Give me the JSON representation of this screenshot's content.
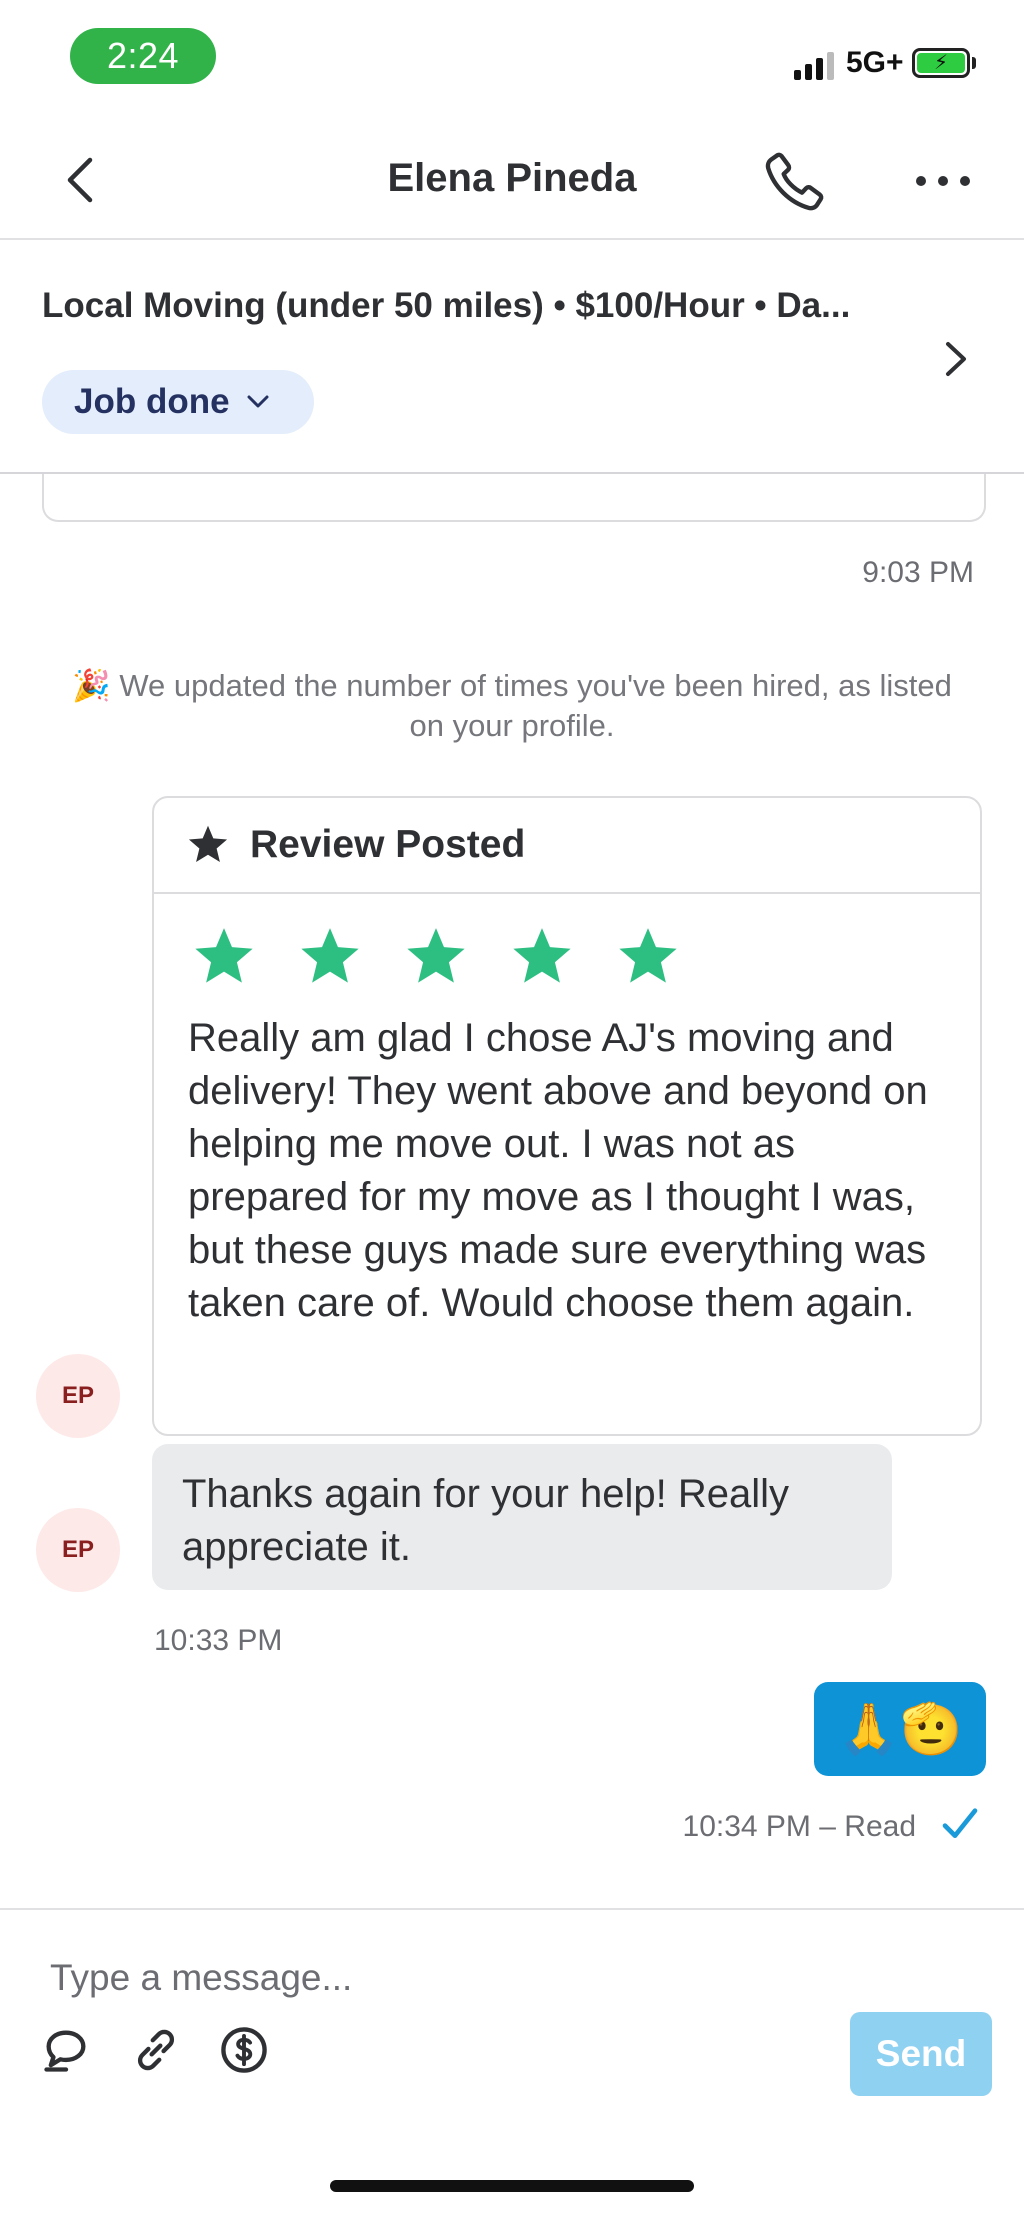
{
  "status_bar": {
    "time": "2:24",
    "network": "5G+"
  },
  "header": {
    "title": "Elena Pineda"
  },
  "job": {
    "title": "Local Moving (under 50 miles) • $100/Hour • Da...",
    "status": "Job done"
  },
  "messages": {
    "timestamp_1": "9:03 PM",
    "system_notice": "We updated the number of times you've been hired, as listed on your profile.",
    "system_emoji": "🎉",
    "review": {
      "heading": "Review Posted",
      "rating": 5,
      "max_rating": 5,
      "text": "Really am glad I chose AJ's moving and delivery! They went above and beyond on helping me move out. I was not as prepared for my move as I thought I was, but these guys made sure everything was taken care of. Would choose them again."
    },
    "avatar_initials": "EP",
    "incoming_text": "Thanks again for your help! Really appreciate it.",
    "timestamp_2": "10:33 PM",
    "outgoing_emoji": "🙏🫡",
    "timestamp_3": "10:34 PM – Read"
  },
  "composer": {
    "placeholder": "Type a message...",
    "send_label": "Send"
  },
  "colors": {
    "accent_green": "#32b34a",
    "star_green": "#2dbf82",
    "send_blue": "#0e94d6",
    "send_disabled": "#8fd1f1"
  },
  "icons": [
    "back-chevron-icon",
    "phone-icon",
    "more-icon",
    "chevron-right-icon",
    "star-icon",
    "quick-reply-icon",
    "attach-icon",
    "dollar-icon",
    "check-icon"
  ]
}
